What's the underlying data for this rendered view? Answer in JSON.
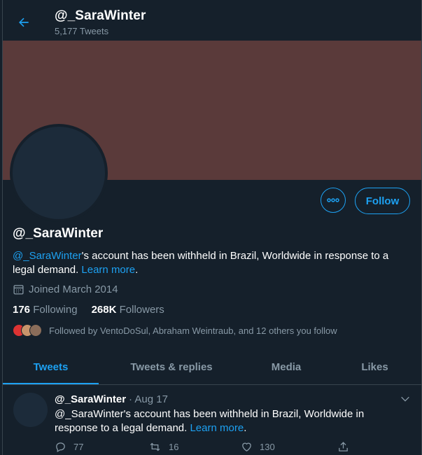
{
  "header": {
    "title": "@_SaraWinter",
    "subtitle": "5,177 Tweets"
  },
  "profile": {
    "name": "@_SaraWinter",
    "follow_label": "Follow",
    "bio": {
      "handle": "@_SaraWinter",
      "text": "'s account has been withheld in Brazil, Worldwide in response to a legal demand. ",
      "learn_more": "Learn more",
      "end": "."
    },
    "joined": "Joined March 2014",
    "following_count": "176",
    "following_label": "Following",
    "followers_count": "268K",
    "followers_label": "Followers",
    "followed_by": "Followed by VentoDoSul, Abraham Weintraub, and 12 others you follow"
  },
  "tabs": [
    {
      "label": "Tweets"
    },
    {
      "label": "Tweets & replies"
    },
    {
      "label": "Media"
    },
    {
      "label": "Likes"
    }
  ],
  "tweet": {
    "name": "@_SaraWinter",
    "date": "· Aug 17",
    "text": "@_SaraWinter's account has been withheld in Brazil, Worldwide in response to a legal demand. ",
    "learn_more": "Learn more",
    "end": ".",
    "replies": "77",
    "retweets": "16",
    "likes": "130"
  },
  "colors": {
    "background": "#15202b",
    "accent": "#1da1f2",
    "banner": "#5a3a3a",
    "muted": "#8899a6"
  }
}
